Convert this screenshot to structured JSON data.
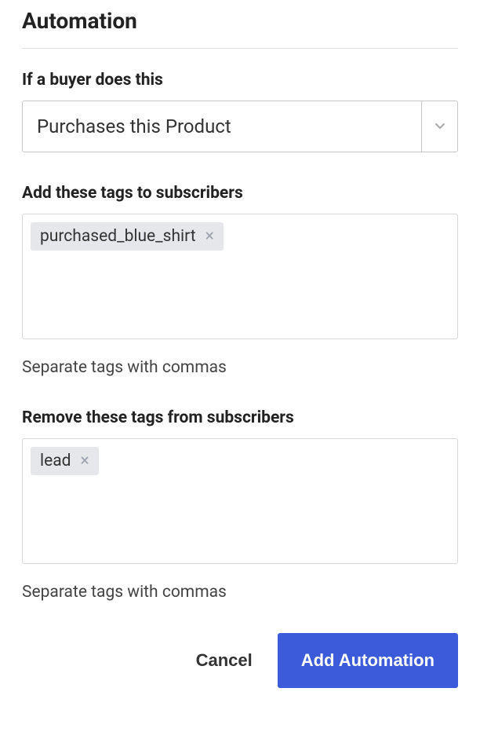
{
  "section_title": "Automation",
  "trigger": {
    "label": "If a buyer does this",
    "selected": "Purchases this Product"
  },
  "add_tags": {
    "label": "Add these tags to subscribers",
    "tags": [
      "purchased_blue_shirt"
    ],
    "helper": "Separate tags with commas"
  },
  "remove_tags": {
    "label": "Remove these tags from subscribers",
    "tags": [
      "lead"
    ],
    "helper": "Separate tags with commas"
  },
  "actions": {
    "cancel": "Cancel",
    "submit": "Add Automation"
  }
}
